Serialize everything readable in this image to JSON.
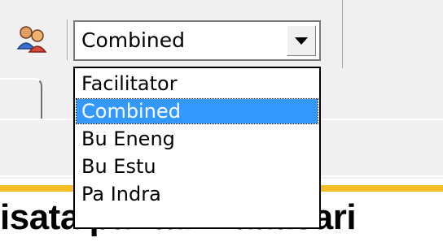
{
  "toolbar": {
    "users_icon": "users-icon",
    "combo": {
      "value": "Combined",
      "chevron_icon": "chevron-down-icon"
    }
  },
  "dropdown": {
    "items": [
      {
        "label": "Facilitator",
        "selected": false
      },
      {
        "label": "Combined",
        "selected": true
      },
      {
        "label": "Bu Eneng",
        "selected": false
      },
      {
        "label": "Bu Estu",
        "selected": false
      },
      {
        "label": "Pa Indra",
        "selected": false
      }
    ]
  },
  "page": {
    "heading": "isata pantai maausari"
  },
  "colors": {
    "selection": "#3399ff",
    "accent_stripe": "#f2bf27",
    "toolbar_bg": "#f0f0f0"
  }
}
